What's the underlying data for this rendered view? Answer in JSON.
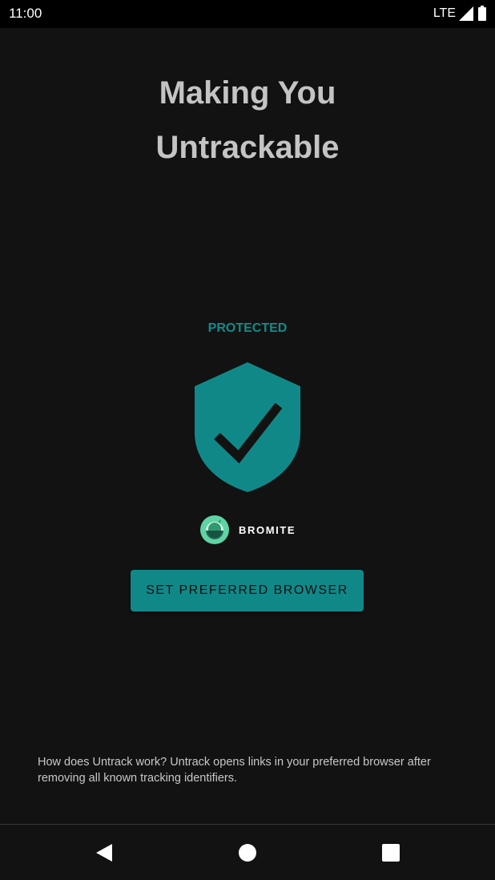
{
  "status_bar": {
    "time": "11:00",
    "network": "LTE",
    "icons": [
      "signal-icon",
      "battery-icon"
    ]
  },
  "header": {
    "title_line1": "Making You",
    "title_line2": "Untrackable"
  },
  "protection": {
    "status": "PROTECTED",
    "icon": "shield-check-icon",
    "accent_color": "#118888"
  },
  "browser": {
    "name": "BROMITE",
    "icon": "bromite-logo-icon"
  },
  "actions": {
    "set_browser_label": "SET PREFERRED BROWSER"
  },
  "info": {
    "description": "How does Untrack work? Untrack opens links in your preferred browser after removing all known tracking identifiers."
  },
  "nav_bar": {
    "icons": [
      "back-icon",
      "home-icon",
      "recents-icon"
    ]
  },
  "colors": {
    "background": "#121212",
    "accent": "#118888",
    "title": "#c4c4c4"
  }
}
